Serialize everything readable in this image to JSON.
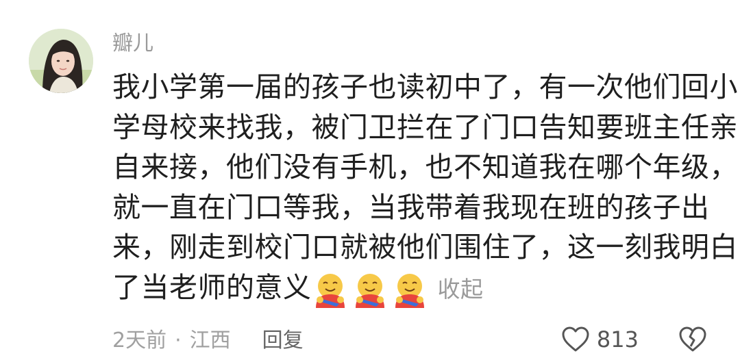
{
  "comment": {
    "username": "瓣儿",
    "body_lines": [
      "我小学第一届的孩子也读初中了，有一次他们回小",
      "学母校来找我，被门卫拦在了门口告知要班主任亲",
      "自来接，他们没有手机，也不知道我在哪个年级，",
      "就一直在门口等我，当我带着我现在班的孩子出",
      "来，刚走到校门口就被他们围住了，这一刻我明白",
      "了当老师的意义"
    ],
    "emojis": [
      "hug-emoji",
      "hug-emoji",
      "hug-emoji"
    ],
    "collapse_label": "收起",
    "time": "2天前",
    "separator": "·",
    "location": "江西",
    "reply_label": "回复",
    "like_count": "813"
  },
  "icons": {
    "like": "heart-outline-icon",
    "dislike": "broken-heart-icon"
  },
  "colors": {
    "text": "#1f1f1f",
    "muted": "#9a9a9a",
    "emoji_face": "#f7c948",
    "emoji_body": "#e8453c"
  }
}
